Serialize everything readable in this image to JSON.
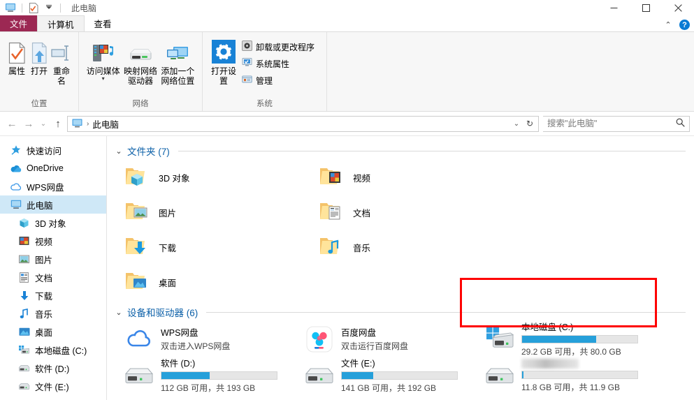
{
  "titlebar": {
    "title": "此电脑",
    "qat_icons": [
      "this-pc-icon",
      "properties-icon",
      "dropdown-icon"
    ],
    "minimize": "—",
    "maximize": "□",
    "close": "✕"
  },
  "tabs": [
    {
      "label": "文件",
      "type": "file"
    },
    {
      "label": "计算机",
      "type": "active"
    },
    {
      "label": "查看",
      "type": "normal"
    }
  ],
  "tab_right": {
    "collapse": "⌃",
    "help": "?"
  },
  "ribbon": {
    "groups": [
      {
        "label": "位置",
        "buttons": [
          {
            "label": "属性",
            "icon": "properties-icon"
          },
          {
            "label": "打开",
            "icon": "open-icon"
          },
          {
            "label": "重命名",
            "icon": "rename-icon"
          }
        ]
      },
      {
        "label": "网络",
        "buttons": [
          {
            "label": "访问媒体",
            "icon": "media-server-icon",
            "caret": "▾"
          },
          {
            "label": "映射网络驱动器",
            "icon": "map-drive-icon",
            "caret": "▾"
          },
          {
            "label": "添加一个网络位置",
            "icon": "add-network-location-icon"
          }
        ]
      },
      {
        "label": "系统",
        "big": {
          "label": "打开设置",
          "icon": "gear-icon"
        },
        "small": [
          {
            "label": "卸载或更改程序",
            "icon": "uninstall-icon"
          },
          {
            "label": "系统属性",
            "icon": "system-properties-icon"
          },
          {
            "label": "管理",
            "icon": "manage-icon"
          }
        ]
      }
    ]
  },
  "addressbar": {
    "back": "←",
    "forward": "→",
    "history": "⌄",
    "up": "↑",
    "crumb_icon": "this-pc-icon",
    "crumb": "此电脑",
    "separator": "›",
    "dropdown": "⌄",
    "refresh": "↻"
  },
  "search": {
    "placeholder": "搜索\"此电脑\"",
    "value": "",
    "icon": "search-icon"
  },
  "navpane": {
    "items": [
      {
        "label": "快速访问",
        "icon": "pin-star-icon",
        "level": 0,
        "selected": false
      },
      {
        "label": "OneDrive",
        "icon": "onedrive-cloud-icon",
        "level": 0,
        "selected": false
      },
      {
        "label": "WPS网盘",
        "icon": "wps-cloud-icon",
        "level": 0,
        "selected": false
      },
      {
        "label": "此电脑",
        "icon": "this-pc-icon",
        "level": 0,
        "selected": true
      },
      {
        "label": "3D 对象",
        "icon": "3d-objects-icon",
        "level": 1,
        "selected": false
      },
      {
        "label": "视频",
        "icon": "videos-icon",
        "level": 1,
        "selected": false
      },
      {
        "label": "图片",
        "icon": "pictures-icon",
        "level": 1,
        "selected": false
      },
      {
        "label": "文档",
        "icon": "documents-icon",
        "level": 1,
        "selected": false
      },
      {
        "label": "下载",
        "icon": "downloads-icon",
        "level": 1,
        "selected": false
      },
      {
        "label": "音乐",
        "icon": "music-icon",
        "level": 1,
        "selected": false
      },
      {
        "label": "桌面",
        "icon": "desktop-icon",
        "level": 1,
        "selected": false
      },
      {
        "label": "本地磁盘 (C:)",
        "icon": "windows-drive-icon",
        "level": 1,
        "selected": false
      },
      {
        "label": "软件 (D:)",
        "icon": "drive-icon",
        "level": 1,
        "selected": false
      },
      {
        "label": "文件 (E:)",
        "icon": "drive-icon",
        "level": 1,
        "selected": false
      }
    ]
  },
  "content": {
    "folders_section": {
      "chevron": "⌄",
      "title": "文件夹 (7)"
    },
    "folders": [
      {
        "name": "3D 对象",
        "icon": "3d-objects-folder-icon"
      },
      {
        "name": "视频",
        "icon": "videos-folder-icon"
      },
      {
        "name": "图片",
        "icon": "pictures-folder-icon"
      },
      {
        "name": "文档",
        "icon": "documents-folder-icon"
      },
      {
        "name": "下载",
        "icon": "downloads-folder-icon"
      },
      {
        "name": "音乐",
        "icon": "music-folder-icon"
      },
      {
        "name": "桌面",
        "icon": "desktop-folder-icon"
      }
    ],
    "devices_section": {
      "chevron": "⌄",
      "title": "设备和驱动器 (6)"
    },
    "devices": [
      {
        "kind": "network-drive",
        "name": "WPS网盘",
        "sub": "双击进入WPS网盘",
        "icon": "wps-cloud-icon"
      },
      {
        "kind": "network-drive",
        "name": "百度网盘",
        "sub": "双击运行百度网盘",
        "icon": "baidu-netdisk-icon"
      },
      {
        "kind": "disk",
        "name": "本地磁盘 (C:)",
        "icon": "windows-drive-icon",
        "capacity_text": "29.2 GB 可用，共 80.0 GB",
        "used_percent": 64,
        "highlighted": true
      },
      {
        "kind": "disk",
        "name": "软件 (D:)",
        "icon": "drive-icon",
        "capacity_text": "112 GB 可用，共 193 GB",
        "used_percent": 42,
        "highlighted": false
      },
      {
        "kind": "disk",
        "name": "文件 (E:)",
        "icon": "drive-icon",
        "capacity_text": "141 GB 可用，共 192 GB",
        "used_percent": 27,
        "highlighted": false
      },
      {
        "kind": "disk",
        "name": "",
        "name_blurred": true,
        "icon": "drive-icon",
        "capacity_text": "11.8 GB 可用，共 11.9 GB",
        "used_percent": 1,
        "highlighted": false
      }
    ]
  },
  "colors": {
    "file_tab": "#9c2853",
    "accent_blue": "#26a0da",
    "section_title": "#0c60a8",
    "selection": "#cfe8f7",
    "highlight_box": "#fe0000"
  }
}
